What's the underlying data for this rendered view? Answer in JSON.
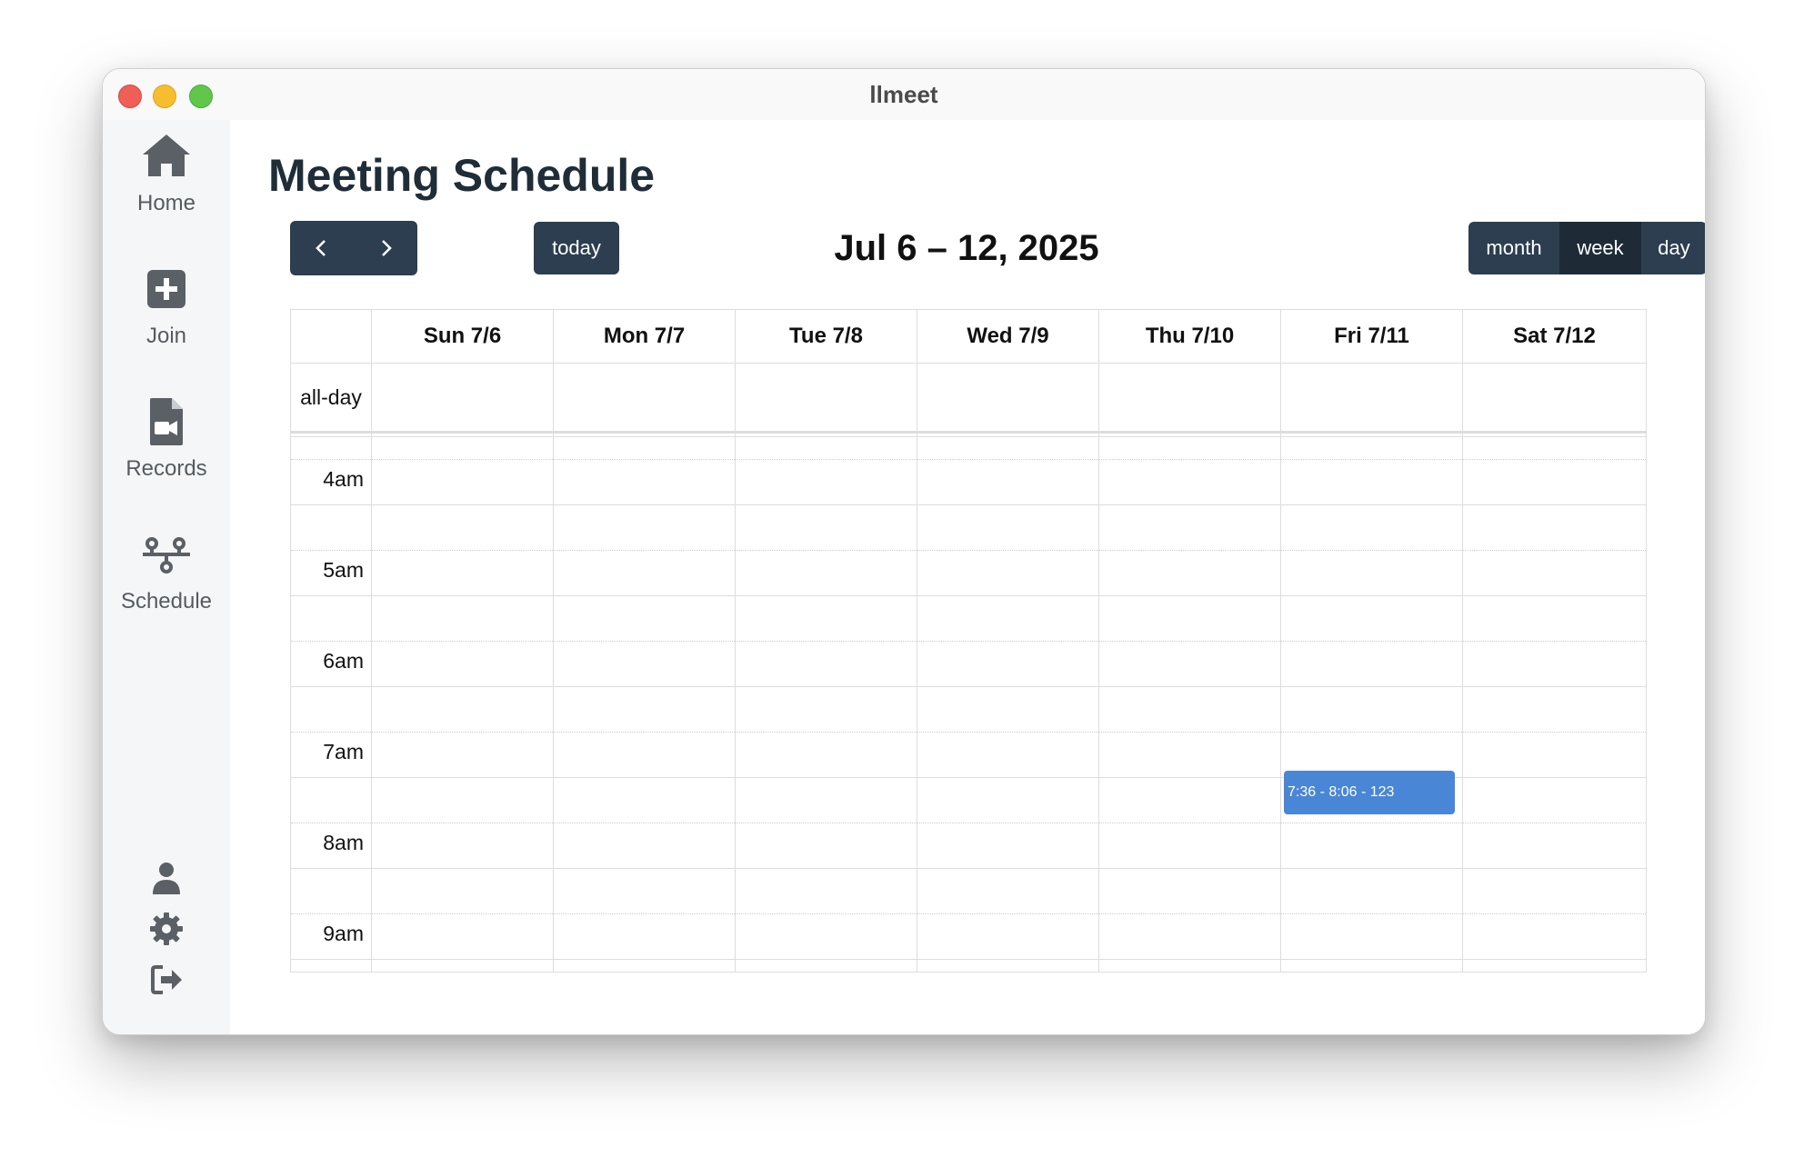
{
  "window": {
    "title": "llmeet"
  },
  "sidebar": {
    "items": [
      {
        "label": "Home",
        "icon": "home-icon"
      },
      {
        "label": "Join",
        "icon": "plus-square-icon"
      },
      {
        "label": "Records",
        "icon": "video-file-icon"
      },
      {
        "label": "Schedule",
        "icon": "schedule-flow-icon"
      }
    ],
    "bottom_icons": [
      "user-icon",
      "gear-icon",
      "logout-icon"
    ]
  },
  "main": {
    "title": "Meeting Schedule",
    "toolbar": {
      "prev_icon": "chevron-left-icon",
      "next_icon": "chevron-right-icon",
      "today_label": "today",
      "range_title": "Jul 6 – 12, 2025",
      "views": [
        {
          "label": "month",
          "active": false
        },
        {
          "label": "week",
          "active": true
        },
        {
          "label": "day",
          "active": false
        }
      ]
    },
    "calendar": {
      "days": [
        "Sun 7/6",
        "Mon 7/7",
        "Tue 7/8",
        "Wed 7/9",
        "Thu 7/10",
        "Fri 7/11",
        "Sat 7/12"
      ],
      "allday_label": "all-day",
      "hours": [
        "4am",
        "5am",
        "6am",
        "7am",
        "8am",
        "9am"
      ],
      "events": [
        {
          "day": "Fri 7/11",
          "label": "7:36 - 8:06 - 123",
          "start": "7:36",
          "end": "8:06",
          "color": "#4a86d6"
        }
      ]
    }
  },
  "colors": {
    "primary": "#2c3e50",
    "primary_active": "#1e2b37",
    "event": "#4a86d6",
    "grid": "#dddddd"
  },
  "scroll_icon": "chevron-down-icon"
}
